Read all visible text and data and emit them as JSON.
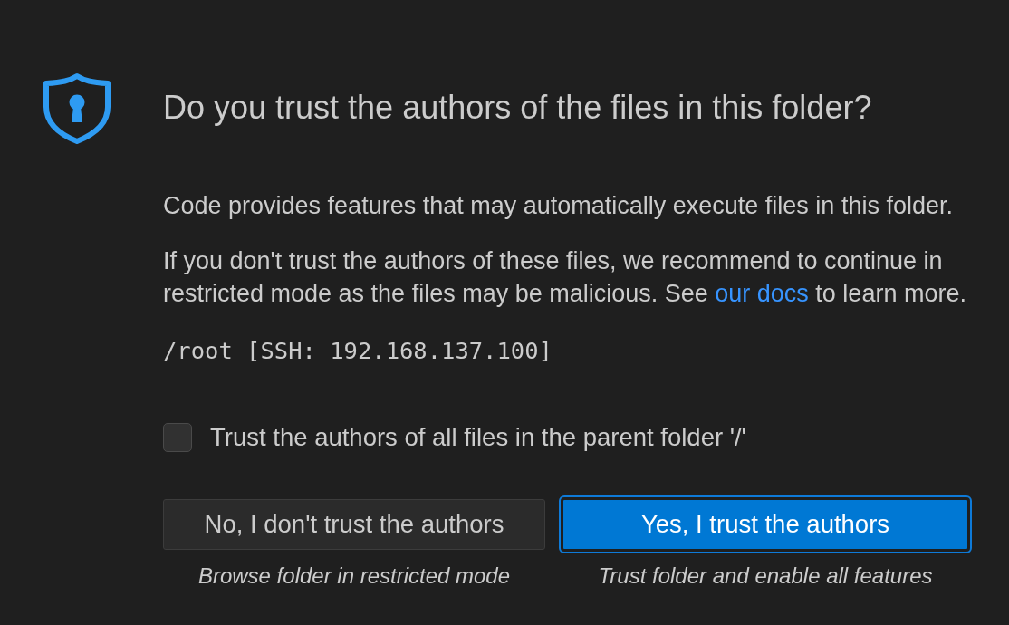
{
  "title": "Do you trust the authors of the files in this folder?",
  "intro": "Code provides features that may automatically execute files in this folder.",
  "warning": {
    "before": "If you don't trust the authors of these files, we recommend to continue in restricted mode as the files may be malicious. See ",
    "link": "our docs",
    "after": " to learn more."
  },
  "path": "/root [SSH: 192.168.137.100]",
  "checkbox": {
    "label": "Trust the authors of all files in the parent folder '/'",
    "checked": false
  },
  "buttons": [
    {
      "label": "No, I don't trust the authors",
      "kind": "secondary",
      "focused": false,
      "caption": "Browse folder in restricted mode"
    },
    {
      "label": "Yes, I trust the authors",
      "kind": "primary",
      "focused": true,
      "caption": "Trust folder and enable all features"
    }
  ]
}
